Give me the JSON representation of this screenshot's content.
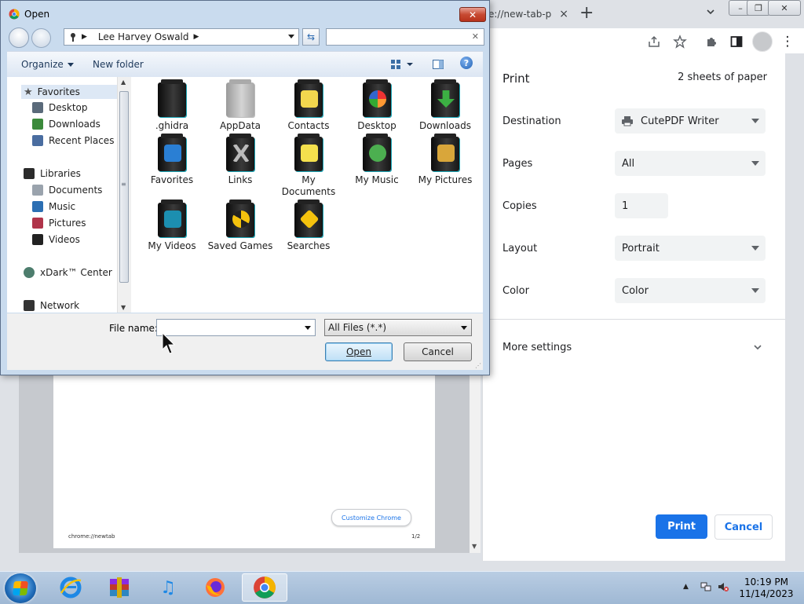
{
  "chrome": {
    "tab_title": "e://new-tab-p",
    "tab_close": "×",
    "new_tab": "+",
    "window_controls": [
      "–",
      "❐",
      "✕"
    ],
    "toolbar_icons": [
      "share-icon",
      "star-icon",
      "extensions-icon",
      "sidepanel-icon",
      "profile-icon",
      "menu-icon"
    ],
    "menu_glyph": "⋮"
  },
  "preview": {
    "customize_label": "Customize Chrome",
    "footer_url": "chrome://newtab",
    "footer_page": "1/2"
  },
  "print_panel": {
    "title": "Print",
    "sheets": "2 sheets of paper",
    "destination_label": "Destination",
    "destination_value": "CutePDF Writer",
    "pages_label": "Pages",
    "pages_value": "All",
    "copies_label": "Copies",
    "copies_value": "1",
    "layout_label": "Layout",
    "layout_value": "Portrait",
    "color_label": "Color",
    "color_value": "Color",
    "more_settings": "More settings",
    "print_button": "Print",
    "cancel_button": "Cancel",
    "accent": "#1a73e8"
  },
  "dialog": {
    "title": "Open",
    "breadcrumb": "Lee Harvey Oswald",
    "search_placeholder": "",
    "toolbar": {
      "organize": "Organize",
      "new_folder": "New folder"
    },
    "nav": {
      "favorites": "Favorites",
      "favorites_items": [
        "Desktop",
        "Downloads",
        "Recent Places"
      ],
      "libraries": "Libraries",
      "libraries_items": [
        "Documents",
        "Music",
        "Pictures",
        "Videos"
      ],
      "xdark": "xDark™ Center",
      "network": "Network"
    },
    "files": [
      ".ghidra",
      "AppData",
      "Contacts",
      "Desktop",
      "Downloads",
      "Favorites",
      "Links",
      "My Documents",
      "My Music",
      "My Pictures",
      "My Videos",
      "Saved Games",
      "Searches"
    ],
    "file_name_label": "File name:",
    "file_name_value": "",
    "file_type": "All Files (*.*)",
    "open_button": "Open",
    "cancel_button": "Cancel"
  },
  "taskbar": {
    "apps": [
      "ie-icon",
      "winrar-icon",
      "music-icon",
      "firefox-icon",
      "chrome-icon"
    ],
    "time": "10:19 PM",
    "date": "11/14/2023"
  }
}
